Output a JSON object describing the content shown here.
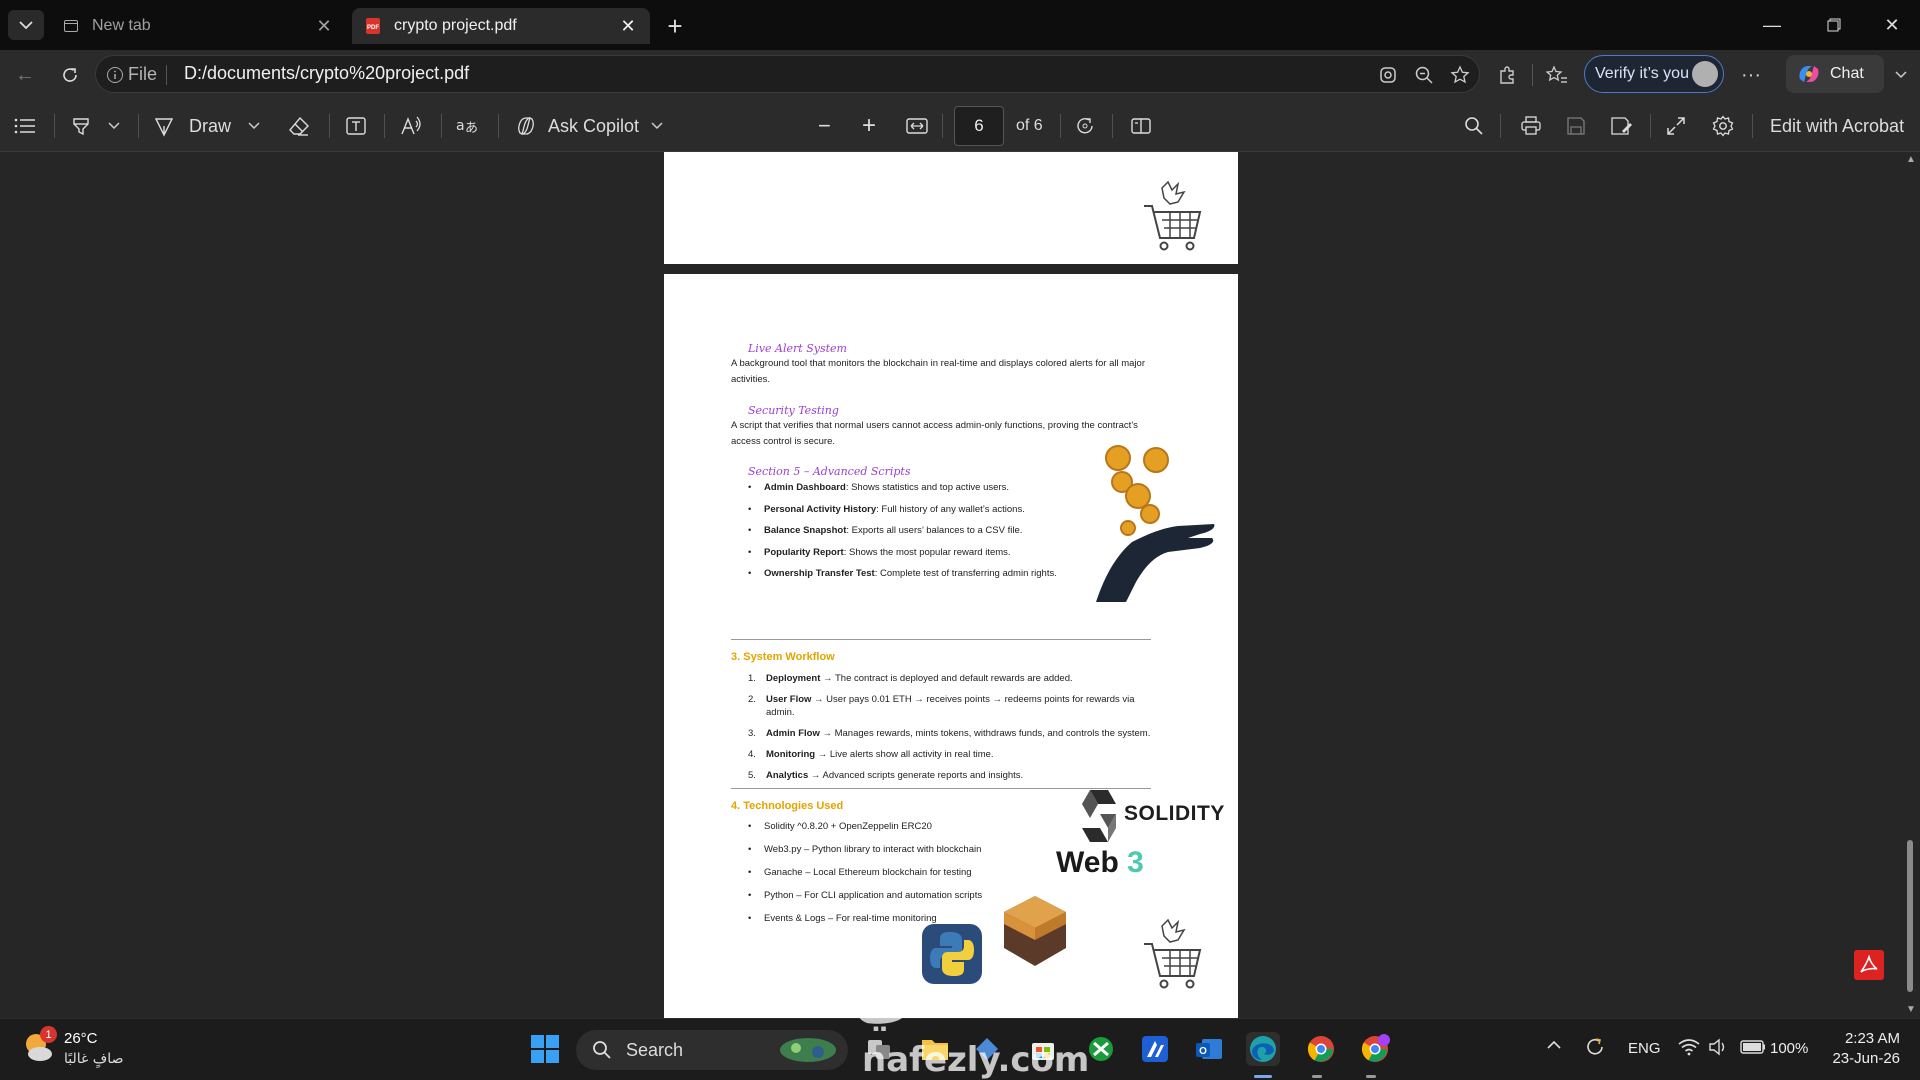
{
  "tabs": [
    {
      "title": "New tab"
    },
    {
      "title": "crypto project.pdf"
    }
  ],
  "address": {
    "scheme_label": "File",
    "url": "D:/documents/crypto%20project.pdf"
  },
  "profile": {
    "verify_label": "Verify it’s you"
  },
  "chat": {
    "label": "Chat"
  },
  "pdf_toolbar": {
    "draw_label": "Draw",
    "copilot_label": "Ask Copilot",
    "page_current": "6",
    "page_total": "of 6",
    "edit_label": "Edit with Acrobat"
  },
  "pdf_page": {
    "live_alert": {
      "heading": "Live Alert System",
      "body": "A background tool that monitors the blockchain in real-time and displays colored alerts for all major activities."
    },
    "security": {
      "heading": "Security Testing",
      "body": "A script that verifies that normal users cannot access admin-only functions, proving the contract’s access control is secure."
    },
    "section5": {
      "heading": "Section 5 – Advanced Scripts",
      "items": [
        {
          "term": "Admin Dashboard",
          "desc": ": Shows statistics and top active users."
        },
        {
          "term": "Personal Activity History",
          "desc": ": Full history of any wallet’s actions."
        },
        {
          "term": "Balance Snapshot",
          "desc": ": Exports all users’ balances to a CSV file."
        },
        {
          "term": "Popularity Report",
          "desc": ": Shows the most popular reward items."
        },
        {
          "term": "Ownership Transfer Test",
          "desc": ": Complete test of transferring admin rights."
        }
      ]
    },
    "workflow": {
      "heading": "3. System Workflow",
      "items": [
        {
          "num": "1.",
          "term": "Deployment",
          "desc": " → The contract is deployed and default rewards are added."
        },
        {
          "num": "2.",
          "term": "User Flow",
          "desc": " → User pays 0.01 ETH → receives points → redeems points for rewards via admin."
        },
        {
          "num": "3.",
          "term": "Admin Flow",
          "desc": " → Manages rewards, mints tokens, withdraws funds, and controls the system."
        },
        {
          "num": "4.",
          "term": "Monitoring",
          "desc": " → Live alerts show all activity in real time."
        },
        {
          "num": "5.",
          "term": "Analytics",
          "desc": " → Advanced scripts generate reports and insights."
        }
      ]
    },
    "tech": {
      "heading": "4. Technologies Used",
      "items": [
        "Solidity ^0.8.20 + OpenZeppelin ERC20",
        "Web3.py – Python library to interact with blockchain",
        "Ganache – Local Ethereum blockchain for testing",
        "Python – For CLI application and automation scripts",
        "Events & Logs – For real-time monitoring"
      ]
    },
    "logos": {
      "solidity": "SOLIDITY",
      "web3_a": "Web",
      "web3_b": "3"
    }
  },
  "watermark": {
    "arabic": "نفعني",
    "latin": "nafezly.com"
  },
  "taskbar": {
    "weather_temp": "26°C",
    "weather_desc": "صافٍ غالبًا",
    "weather_badge": "1",
    "search_label": "Search",
    "lang": "ENG",
    "battery": "100%",
    "time": "2:23 AM",
    "date": "23-Jun-26"
  },
  "colors": {
    "accent_purple": "#9b3fd0",
    "section_gold": "#e3a400",
    "acrobat_red": "#d22222"
  }
}
